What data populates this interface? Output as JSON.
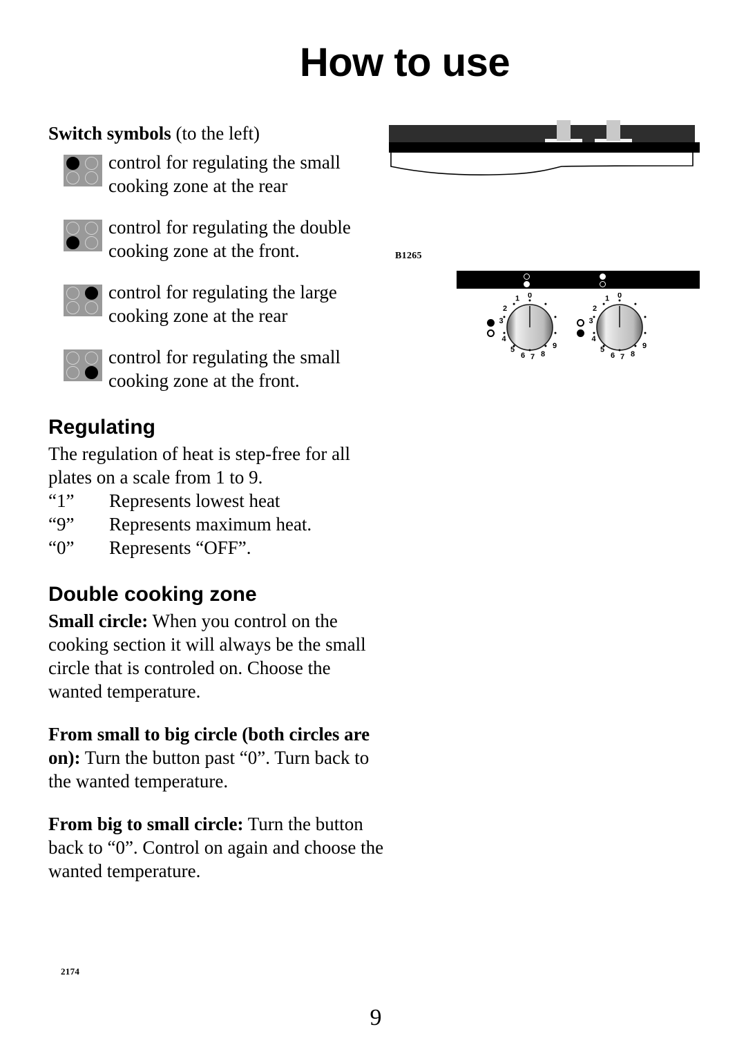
{
  "page": {
    "title": "How to use",
    "page_number": "9",
    "doc_code": "2174"
  },
  "switch_symbols": {
    "heading_bold": "Switch symbols",
    "heading_rest": " (to the left)",
    "items": [
      {
        "icon": "hob-icon-small-rear",
        "active_zone": "top-left",
        "line1": "control for regulating the small",
        "line2": "cooking zone at the rear"
      },
      {
        "icon": "hob-icon-double-front",
        "active_zone": "bottom-left",
        "line1": "control for regulating the double",
        "line2": "cooking zone at the front."
      },
      {
        "icon": "hob-icon-large-rear",
        "active_zone": "top-right",
        "line1": "control for regulating the large",
        "line2": "cooking zone at the rear"
      },
      {
        "icon": "hob-icon-small-front",
        "active_zone": "bottom-right",
        "line1": "control for regulating the small",
        "line2": "cooking zone at the front."
      }
    ]
  },
  "regulating": {
    "heading": "Regulating",
    "intro_line1": "The regulation of heat is step-free for all",
    "intro_line2": "plates on a scale from 1 to 9.",
    "scale": [
      {
        "key": "“1”",
        "desc": "Represents lowest heat"
      },
      {
        "key": "“9”",
        "desc": "Represents maximum heat."
      },
      {
        "key": "“0”",
        "desc": "Represents “OFF”."
      }
    ]
  },
  "double_cooking_zone": {
    "heading": "Double cooking zone",
    "paragraphs": [
      {
        "lead": "Small circle:",
        "body": " When you control on the cooking section it will always be the small circle that is controled on. Choose the wanted temperature."
      },
      {
        "lead": "From small to big circle (both circles are on):",
        "body": " Turn the button past “0”. Turn back to the wanted temperature."
      },
      {
        "lead": "From big to small circle:",
        "body": " Turn the button back to “0”. Control on again and choose the wanted temperature."
      }
    ]
  },
  "figures": {
    "side_view": {
      "name": "cooktop-side-view",
      "label": "B1265",
      "stem_count": 2
    },
    "control_panel": {
      "name": "control-panel-strip",
      "indicators": [
        {
          "top": "hollow",
          "bottom": "filled"
        },
        {
          "top": "filled",
          "bottom": "hollow"
        }
      ]
    },
    "knobs": [
      {
        "name": "knob-left",
        "indicator_top": "filled",
        "indicator_bottom": "hollow",
        "scale": [
          "0",
          "1",
          "2",
          "3",
          "4",
          "5",
          "6",
          "7",
          "8",
          "9"
        ],
        "pointer_value": "0"
      },
      {
        "name": "knob-right",
        "indicator_top": "hollow",
        "indicator_bottom": "filled",
        "scale": [
          "0",
          "1",
          "2",
          "3",
          "4",
          "5",
          "6",
          "7",
          "8",
          "9"
        ],
        "pointer_value": "0"
      }
    ]
  },
  "colors": {
    "hob_plate": "#999999",
    "panel_black": "#000000",
    "side_view_dark": "#2e2e2e",
    "stem_gray": "#c9c9c9"
  }
}
